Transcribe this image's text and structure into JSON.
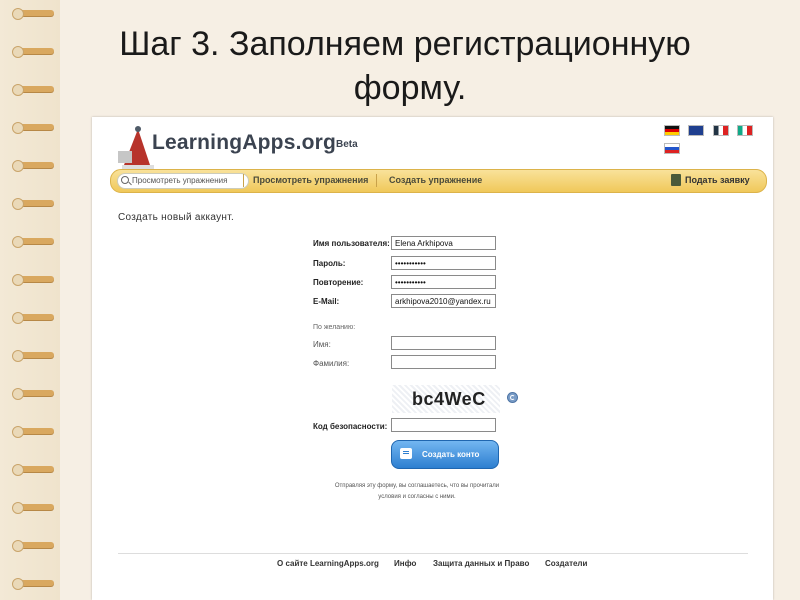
{
  "slide": {
    "title_line1": "Шаг 3. Заполняем регистрационную",
    "title_line2": "форму."
  },
  "site": {
    "logo": "LearningApps.org",
    "beta": "Beta",
    "language_flags": [
      "de-flag-icon",
      "uk-flag-icon",
      "fr-flag-icon",
      "it-flag-icon",
      "ru-flag-icon"
    ]
  },
  "nav": {
    "search_placeholder": "Просмотреть упражнения",
    "browse": "Просмотреть упражнения",
    "create": "Создать упражнение",
    "apply": "Подать заявку"
  },
  "form": {
    "heading": "Создать новый аккаунт.",
    "username_label": "Имя пользователя:",
    "username_value": "Elena Arkhipova",
    "password_label": "Пароль:",
    "password_value": "•••••••••••",
    "repeat_label": "Повторение:",
    "repeat_value": "•••••••••••",
    "email_label": "E-Mail:",
    "email_value": "arkhipova2010@yandex.ru",
    "optional": "По желанию:",
    "firstname_label": "Имя:",
    "lastname_label": "Фамилия:",
    "captcha_text": "bc4WeC",
    "security_label": "Код безопасности:",
    "submit": "Создать конто",
    "terms_line1": "Отправляя эту форму, вы соглашаетесь, что вы прочитали",
    "terms_line2": "условия и согласны с ними."
  },
  "footer": {
    "about": "О сайте LearningApps.org",
    "info": "Инфо",
    "privacy": "Защита данных и Право",
    "creators": "Создатели"
  },
  "colors": {
    "nav_bar": "#f0c85a",
    "button": "#2d7fd0",
    "slide_bg": "#f6efe4"
  }
}
